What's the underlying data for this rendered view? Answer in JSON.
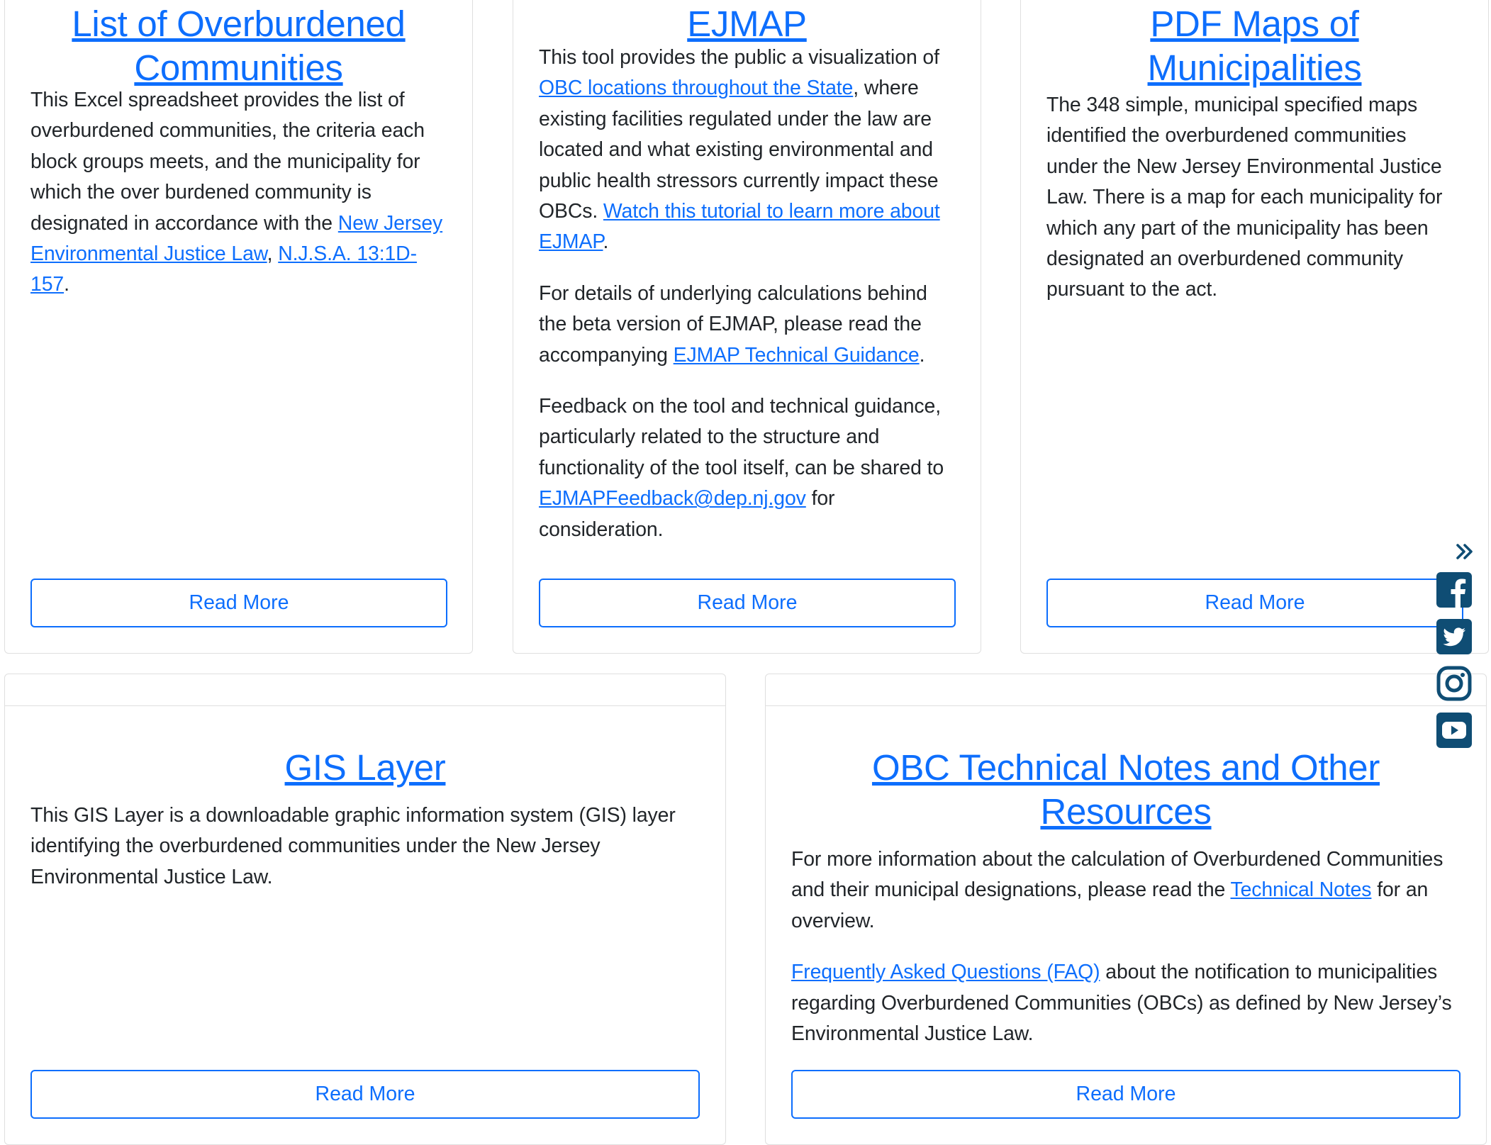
{
  "cards_top": [
    {
      "title": "List of Overburdened Communities",
      "paragraphs": [
        {
          "parts": [
            {
              "text": "This Excel spreadsheet provides the list of overburdened communities, the criteria each block groups meets, and the municipality for which the over burdened community is designated in accordance with the "
            },
            {
              "link": "New Jersey Environmental Justice Law"
            },
            {
              "text": ", "
            },
            {
              "link": "N.J.S.A. 13:1D-157"
            },
            {
              "text": "."
            }
          ]
        }
      ],
      "button": "Read More"
    },
    {
      "title": "EJMAP",
      "paragraphs": [
        {
          "parts": [
            {
              "text": "This tool provides the public a visualization of "
            },
            {
              "link": "OBC locations throughout the State"
            },
            {
              "text": ", where existing facilities regulated under the law are located and what existing environmental and public health stressors currently impact these OBCs. "
            },
            {
              "link": "Watch this tutorial to learn more about EJMAP"
            },
            {
              "text": "."
            }
          ]
        },
        {
          "parts": [
            {
              "text": "For details of underlying calculations behind the beta version of EJMAP, please read the accompanying "
            },
            {
              "link": "EJMAP Technical Guidance"
            },
            {
              "text": "."
            }
          ]
        },
        {
          "parts": [
            {
              "text": "Feedback on the tool and technical guidance, particularly related to the structure and functionality of the tool itself, can be shared to "
            },
            {
              "link": "EJMAPFeedback@dep.nj.gov"
            },
            {
              "text": " for consideration."
            }
          ]
        }
      ],
      "button": "Read More"
    },
    {
      "title": "PDF Maps of Municipalities",
      "paragraphs": [
        {
          "parts": [
            {
              "text": "The 348 simple, municipal specified maps identified the overburdened communities under the New Jersey Environmental Justice Law. There is a map for each municipality for which any part of the municipality has been designated an overburdened community pursuant to the act."
            }
          ]
        }
      ],
      "button": "Read More"
    }
  ],
  "cards_bottom": [
    {
      "title": "GIS Layer",
      "paragraphs": [
        {
          "parts": [
            {
              "text": "This GIS Layer is a downloadable graphic information system (GIS) layer identifying the overburdened communities under the New Jersey Environmental Justice Law."
            }
          ]
        }
      ],
      "button": "Read More"
    },
    {
      "title": "OBC Technical Notes and Other Resources",
      "paragraphs": [
        {
          "parts": [
            {
              "text": "For more information about the calculation of Overburdened Communities and their municipal designations, please read the "
            },
            {
              "link": "Technical Notes"
            },
            {
              "text": " for an overview."
            }
          ]
        },
        {
          "parts": [
            {
              "link": "Frequently Asked Questions (FAQ)"
            },
            {
              "text": " about the notification to municipalities regarding Overburdened Communities (OBCs) as defined by New Jersey’s Environmental Justice Law."
            }
          ]
        }
      ],
      "button": "Read More"
    }
  ],
  "social": {
    "color": "#0f4d74",
    "icons": [
      "facebook-icon",
      "twitter-icon",
      "instagram-icon",
      "youtube-icon"
    ],
    "collapse_icon": "double-chevron-right-icon"
  },
  "colors": {
    "link": "#0d6efd",
    "text": "#212529",
    "border": "#dfdfdf"
  }
}
